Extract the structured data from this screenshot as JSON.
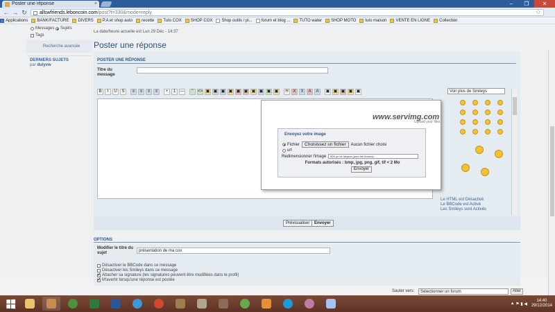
{
  "browser": {
    "tab_title": "Poster une réponse",
    "tab_close": "×",
    "url_host": "allswfriends.leboncoin.com",
    "url_path": "/post?t=330&mode=reply",
    "window_controls": [
      "–",
      "❐",
      "✕"
    ],
    "bookmarks": [
      "Applications",
      "BANK/FACTURE",
      "DIVERS",
      "P.A et shop auto",
      "recette",
      "Tuto COX",
      "SHOP COX",
      "Shop outils / pi...",
      "forum et blog ...",
      "TUTO water",
      "SHOP MOTO",
      "tuto maison",
      "VENTE EN LIGNE",
      "Collection"
    ]
  },
  "sidebar": {
    "search_opt_messages": "Messages",
    "search_opt_sujets": "Sujets",
    "search_opt_tags": "Tags",
    "advanced_search": "Recherche avancée",
    "latest_topics_title": "DERNIERS SUJETS",
    "by_label": "par",
    "by_user": "dulyvw"
  },
  "main": {
    "datetime": "La date/heure actuelle est Lun 29 Déc - 14:37",
    "page_title": "Poster une réponse",
    "post_heading": "POSTER UNE RÉPONSE",
    "title_label": "Titre du message",
    "title_value": "",
    "toolbar": [
      "B",
      "I",
      "U",
      "S",
      "≡",
      "≡",
      "≡",
      "≡",
      "•",
      "1",
      "—",
      "\"",
      "<>",
      "▣",
      "▣",
      "▣",
      "▣",
      "▣",
      "▣",
      "▣",
      "▣",
      "▣",
      "▣",
      "H",
      "X",
      "X",
      "A",
      "A",
      "▣",
      "▣",
      "▣",
      "▣",
      "▣"
    ],
    "smiley_select": "Voir plus de Smileys",
    "html_status": "Le HTML est Désactivé",
    "bbcode_status": "Le BBCode est Activé",
    "smileys_status": "Les Smileys sont Activés",
    "preview_button": "Prévisualiser",
    "send_button": "Envoyer",
    "options_heading": "OPTIONS",
    "subject_label": "Modifier le titre du sujet",
    "subject_value": "présentation de ma cox",
    "options": [
      {
        "label": "Désactiver le BBCode dans ce message",
        "checked": false
      },
      {
        "label": "Désactiver les Smileys dans ce message",
        "checked": false
      },
      {
        "label": "Attacher sa signature (les signatures peuvent être modifiées dans le profil)",
        "checked": true
      },
      {
        "label": "M'avertir lorsqu'une réponse est postée",
        "checked": true
      }
    ],
    "jump_label": "Sauter vers:",
    "jump_value": "Sélectionner un forum",
    "jump_go": "Aller"
  },
  "popup": {
    "logo": "www.servimg.com",
    "logo_sub": "Upload your files",
    "upload_title": "Envoyez votre image",
    "opt_file": "Fichier",
    "choose_file_button": "Choisissez un fichier",
    "no_file": "Aucun fichier choisi",
    "opt_url": "url",
    "resize_label": "Redimensionner l'image",
    "resize_value": "800 px de largeur (pour les forums)",
    "formats": "Formats autorisés : bmp, jpg, png, gif, tif < 2 Mo",
    "send_button": "Envoyer"
  },
  "taskbar": {
    "time": "14:40",
    "date": "29/12/2014"
  }
}
